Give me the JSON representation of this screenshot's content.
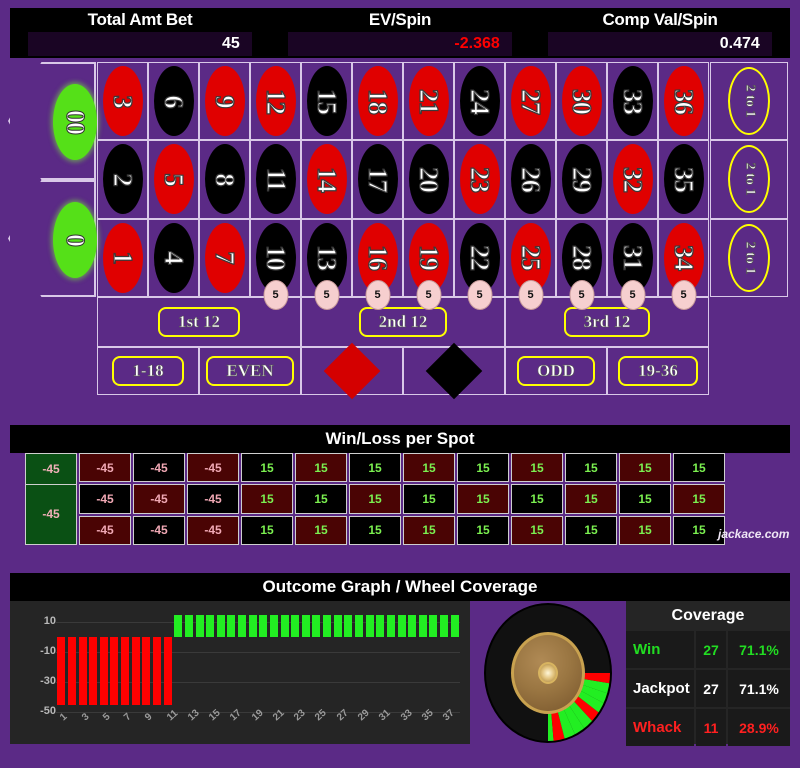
{
  "header": {
    "stats": [
      {
        "title": "Total Amt Bet",
        "value": "45",
        "negative": false
      },
      {
        "title": "EV/Spin",
        "value": "-2.368",
        "negative": true
      },
      {
        "title": "Comp Val/Spin",
        "value": "0.474",
        "negative": false
      }
    ]
  },
  "table": {
    "zeros": [
      {
        "label": "00",
        "name": "double-zero"
      },
      {
        "label": "0",
        "name": "zero"
      }
    ],
    "numbers": [
      {
        "n": "3",
        "color": "red",
        "chip": null
      },
      {
        "n": "6",
        "color": "black",
        "chip": null
      },
      {
        "n": "9",
        "color": "red",
        "chip": null
      },
      {
        "n": "12",
        "color": "red",
        "chip": null
      },
      {
        "n": "15",
        "color": "black",
        "chip": null
      },
      {
        "n": "18",
        "color": "red",
        "chip": null
      },
      {
        "n": "21",
        "color": "red",
        "chip": null
      },
      {
        "n": "24",
        "color": "black",
        "chip": null
      },
      {
        "n": "27",
        "color": "red",
        "chip": null
      },
      {
        "n": "30",
        "color": "red",
        "chip": null
      },
      {
        "n": "33",
        "color": "black",
        "chip": null
      },
      {
        "n": "36",
        "color": "red",
        "chip": null
      },
      {
        "n": "2",
        "color": "black",
        "chip": null
      },
      {
        "n": "5",
        "color": "red",
        "chip": null
      },
      {
        "n": "8",
        "color": "black",
        "chip": null
      },
      {
        "n": "11",
        "color": "black",
        "chip": null
      },
      {
        "n": "14",
        "color": "red",
        "chip": null
      },
      {
        "n": "17",
        "color": "black",
        "chip": null
      },
      {
        "n": "20",
        "color": "black",
        "chip": null
      },
      {
        "n": "23",
        "color": "red",
        "chip": null
      },
      {
        "n": "26",
        "color": "black",
        "chip": null
      },
      {
        "n": "29",
        "color": "black",
        "chip": null
      },
      {
        "n": "32",
        "color": "red",
        "chip": null
      },
      {
        "n": "35",
        "color": "black",
        "chip": null
      },
      {
        "n": "1",
        "color": "red",
        "chip": null
      },
      {
        "n": "4",
        "color": "black",
        "chip": null
      },
      {
        "n": "7",
        "color": "red",
        "chip": null
      },
      {
        "n": "10",
        "color": "black",
        "chip": "5"
      },
      {
        "n": "13",
        "color": "black",
        "chip": "5"
      },
      {
        "n": "16",
        "color": "red",
        "chip": "5"
      },
      {
        "n": "19",
        "color": "red",
        "chip": "5"
      },
      {
        "n": "22",
        "color": "black",
        "chip": "5"
      },
      {
        "n": "25",
        "color": "red",
        "chip": "5"
      },
      {
        "n": "28",
        "color": "black",
        "chip": "5"
      },
      {
        "n": "31",
        "color": "black",
        "chip": "5"
      },
      {
        "n": "34",
        "color": "red",
        "chip": "5"
      }
    ],
    "column_bets": [
      "2 to 1",
      "2 to 1",
      "2 to 1"
    ],
    "dozens": [
      "1st 12",
      "2nd 12",
      "3rd 12"
    ],
    "outside": [
      {
        "label": "1-18",
        "kind": "text"
      },
      {
        "label": "EVEN",
        "kind": "text"
      },
      {
        "label": "RED",
        "kind": "diamond-red"
      },
      {
        "label": "BLACK",
        "kind": "diamond-black"
      },
      {
        "label": "ODD",
        "kind": "text"
      },
      {
        "label": "19-36",
        "kind": "text"
      }
    ]
  },
  "winloss": {
    "title": "Win/Loss per Spot",
    "zero_values": [
      "-45",
      "-45"
    ],
    "values": [
      [
        "-45",
        "-45",
        "-45",
        "15",
        "15",
        "15",
        "15",
        "15",
        "15",
        "15",
        "15",
        "15"
      ],
      [
        "-45",
        "-45",
        "-45",
        "15",
        "15",
        "15",
        "15",
        "15",
        "15",
        "15",
        "15",
        "15"
      ],
      [
        "-45",
        "-45",
        "-45",
        "15",
        "15",
        "15",
        "15",
        "15",
        "15",
        "15",
        "15",
        "15"
      ]
    ],
    "watermark": "jackace.com"
  },
  "outcome": {
    "title": "Outcome Graph / Wheel Coverage"
  },
  "chart_data": {
    "type": "bar",
    "title": "Outcome Graph / Wheel Coverage",
    "xlabel": "",
    "ylabel": "",
    "ylim": [
      -50,
      20
    ],
    "yticks": [
      10,
      -10,
      -30,
      -50
    ],
    "grid": true,
    "legend": null,
    "x": [
      1,
      2,
      3,
      4,
      5,
      6,
      7,
      8,
      9,
      10,
      11,
      12,
      13,
      14,
      15,
      16,
      17,
      18,
      19,
      20,
      21,
      22,
      23,
      24,
      25,
      26,
      27,
      28,
      29,
      30,
      31,
      32,
      33,
      34,
      35,
      36,
      37,
      38
    ],
    "xticklabels": [
      "1",
      "3",
      "5",
      "7",
      "9",
      "11",
      "13",
      "15",
      "17",
      "19",
      "21",
      "23",
      "25",
      "27",
      "29",
      "31",
      "33",
      "35",
      "37"
    ],
    "values": [
      -45,
      -45,
      -45,
      -45,
      -45,
      -45,
      -45,
      -45,
      -45,
      -45,
      -45,
      15,
      15,
      15,
      15,
      15,
      15,
      15,
      15,
      15,
      15,
      15,
      15,
      15,
      15,
      15,
      15,
      15,
      15,
      15,
      15,
      15,
      15,
      15,
      15,
      15,
      15,
      15
    ],
    "colors": {
      "negative": "#ff0000",
      "positive": "#22ee22"
    }
  },
  "coverage": {
    "title": "Coverage",
    "rows": [
      {
        "label": "Win",
        "count": "27",
        "pct": "71.1%",
        "style": "win"
      },
      {
        "label": "Jackpot",
        "count": "27",
        "pct": "71.1%",
        "style": "jackpot"
      },
      {
        "label": "Whack",
        "count": "11",
        "pct": "28.9%",
        "style": "whack"
      }
    ]
  },
  "wheel": {
    "win_color": "#22ee22",
    "whack_color": "#ff0000",
    "segments": 38,
    "win_segments": 27,
    "whack_segments": 11
  }
}
